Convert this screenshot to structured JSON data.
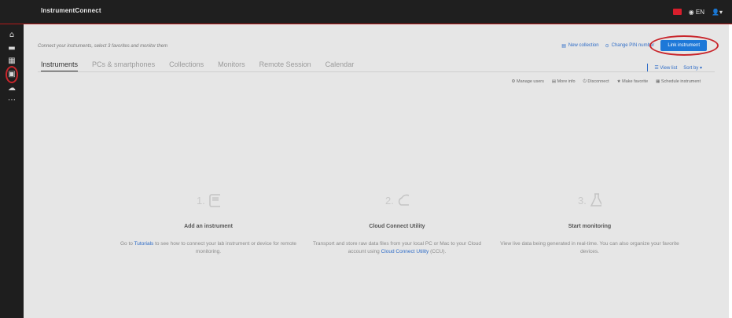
{
  "app": {
    "name": "InstrumentConnect"
  },
  "topbar": {
    "lang": "EN"
  },
  "header": {
    "instructions": "Connect your instruments, select 3 favorites and monitor them",
    "new_collection": "New collection",
    "change_pin": "Change PIN number",
    "link_instrument": "Link instrument"
  },
  "tabs": [
    "Instruments",
    "PCs & smartphones",
    "Collections",
    "Monitors",
    "Remote Session",
    "Calendar"
  ],
  "view": {
    "view_list": "View list",
    "sort_by": "Sort by"
  },
  "actions": [
    "Manage users",
    "More info",
    "Disconnect",
    "Make favorite",
    "Schedule instrument"
  ],
  "steps": [
    {
      "num": "1.",
      "title": "Add an instrument",
      "desc_pre": "Go to ",
      "desc_link": "Tutorials",
      "desc_post": " to see how to connect your lab instrument or device for remote monitoring."
    },
    {
      "num": "2.",
      "title": "Cloud Connect Utility",
      "desc_pre": "Transport and store raw data files from your local PC or Mac to your Cloud account using ",
      "desc_link": "Cloud Connect Utility",
      "desc_post": " (CCU)."
    },
    {
      "num": "3.",
      "title": "Start monitoring",
      "desc_pre": "View live data being generated in real-time. You can also organize your favorite devices.",
      "desc_link": "",
      "desc_post": ""
    }
  ],
  "colors": {
    "accent": "#1d78d8",
    "brand_red": "#c9262c",
    "sidebar": "#1e1e1e"
  }
}
